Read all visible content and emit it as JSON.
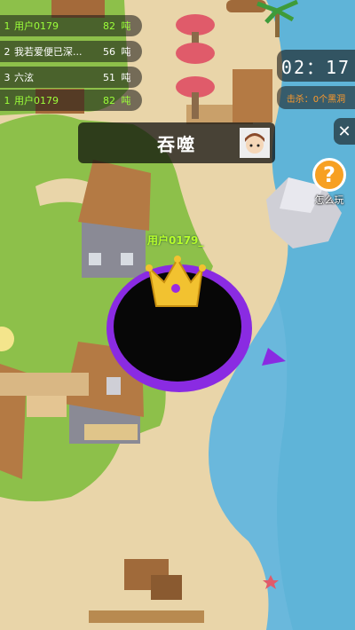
{
  "leaderboard": [
    {
      "rank": "1",
      "name": "用户0179",
      "score": "82",
      "unit": "吨",
      "me": true
    },
    {
      "rank": "2",
      "name": "我若爱便已深...",
      "score": "56",
      "unit": "吨",
      "me": false
    },
    {
      "rank": "3",
      "name": "六泫",
      "score": "51",
      "unit": "吨",
      "me": false
    },
    {
      "rank": "1",
      "name": "用户0179",
      "score": "82",
      "unit": "吨",
      "me": true
    }
  ],
  "timer": "02：17",
  "kill_text": "击杀：0个黑洞",
  "close_label": "✕",
  "swallow_label": "吞噬",
  "howto_label": "怎么玩",
  "howto_icon": "?",
  "player_label": "用户0179_",
  "colors": {
    "sea": "#6ab8dc",
    "sand": "#e8d3a8",
    "grass": "#8bbf4a",
    "ring": "#8a2be2",
    "gold": "#f2c230"
  },
  "icons": [
    "crown-icon",
    "question-icon",
    "close-icon",
    "avatar-icon",
    "pointer-arrow-icon"
  ]
}
